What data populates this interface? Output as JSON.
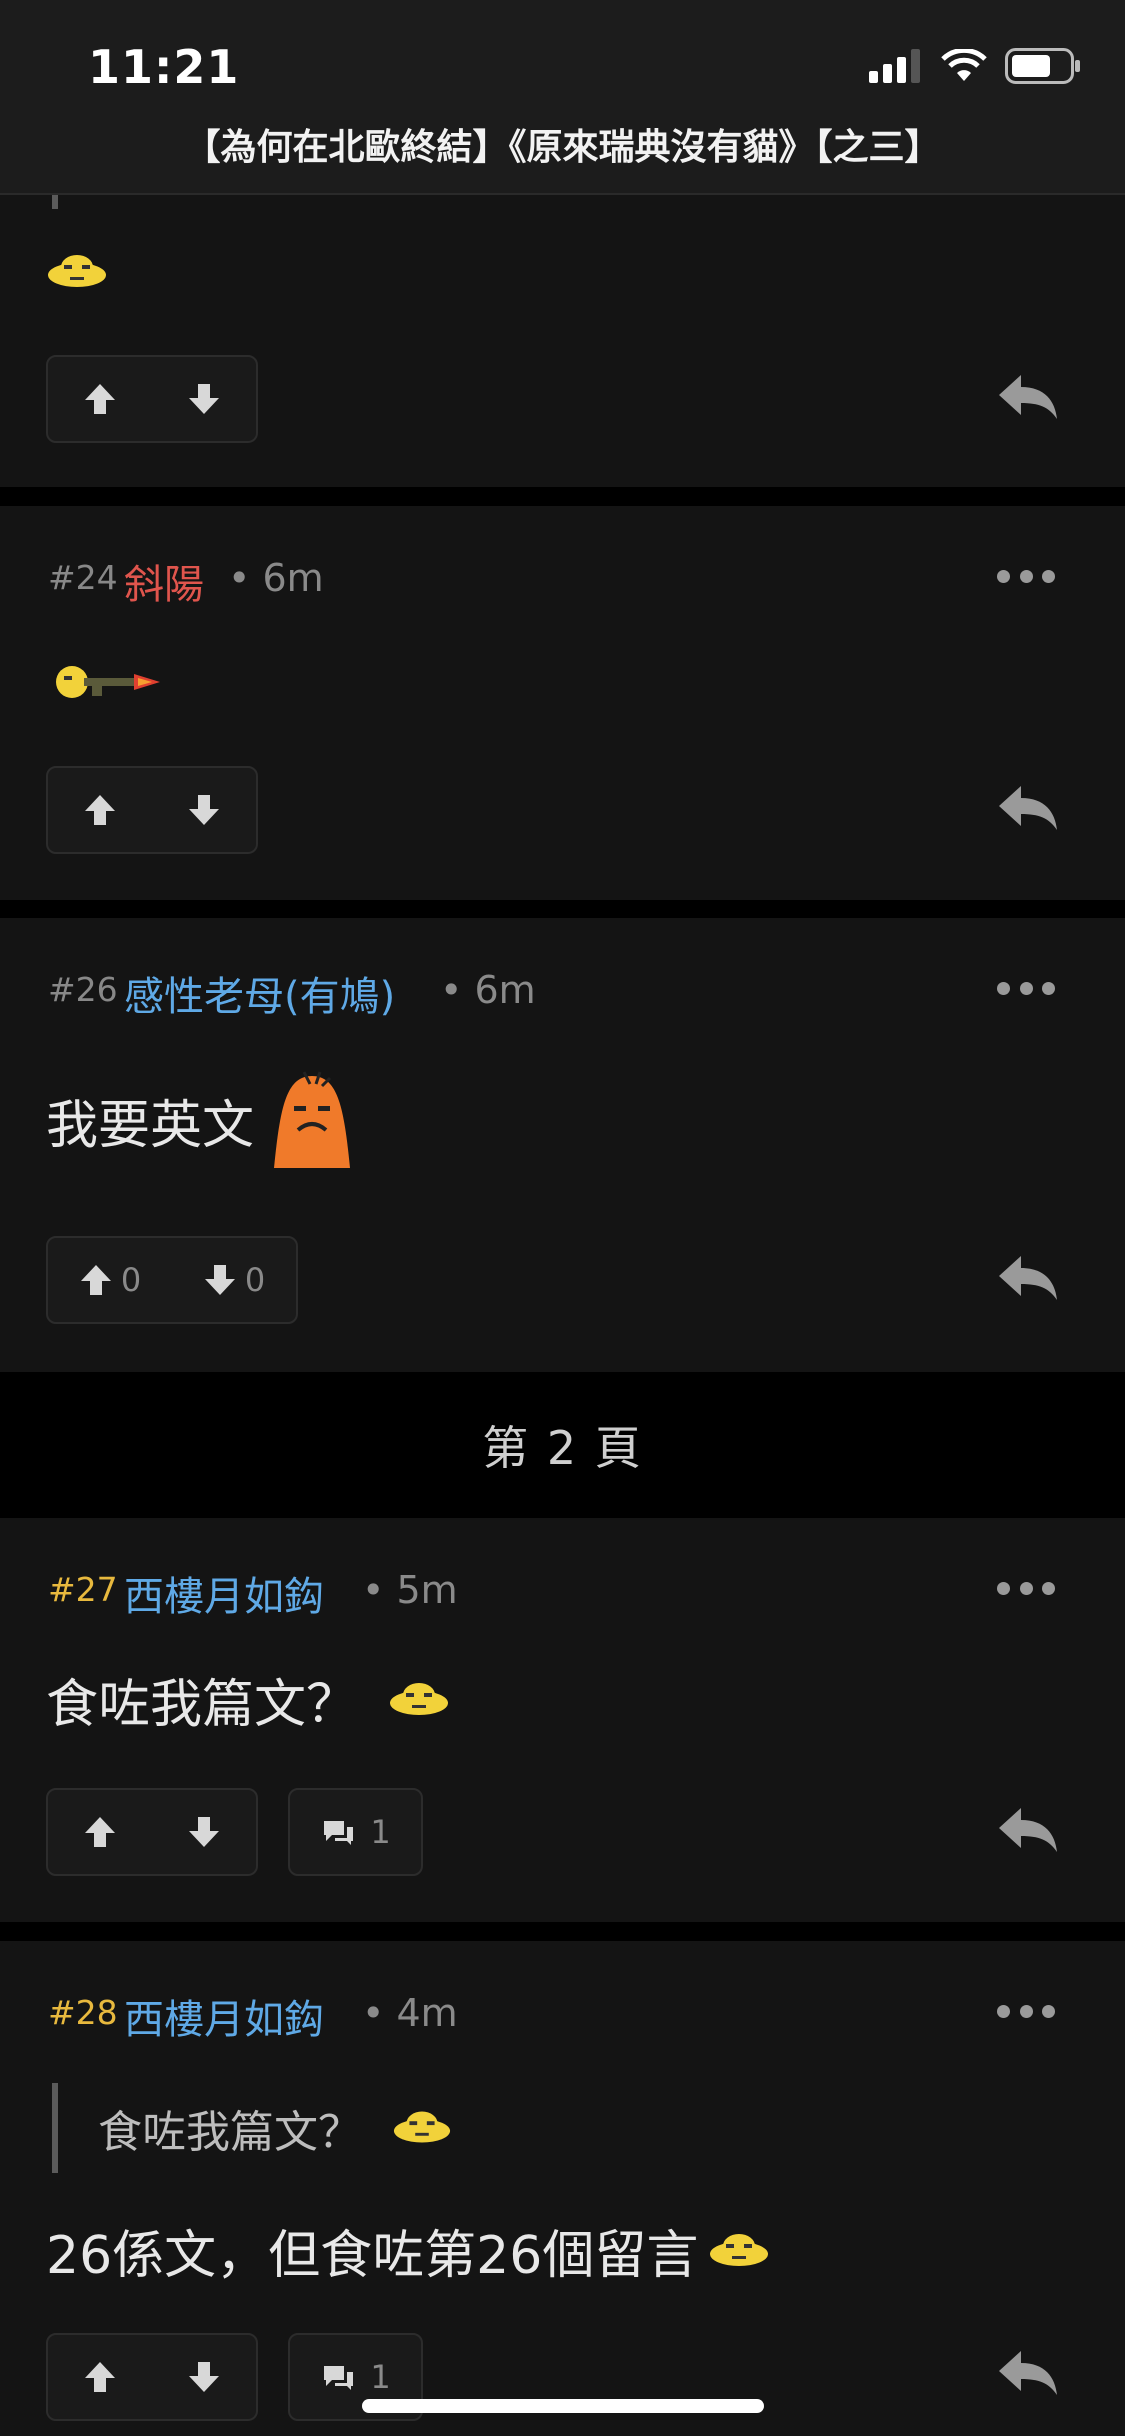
{
  "status_bar": {
    "time": "11:21"
  },
  "header": {
    "title": "【為何在北歐終結】《原來瑞典沒有貓》【之三】"
  },
  "posts": [
    {
      "number": "#24",
      "username": "斜陽",
      "time": "• 6m"
    },
    {
      "number": "#26",
      "username": "感性老母(有鳩)",
      "time": "• 6m",
      "text": "我要英文",
      "upvotes": "0",
      "downvotes": "0"
    },
    {
      "number": "#27",
      "username": "西樓月如鈎",
      "time": "• 5m",
      "text": "食咗我篇文？",
      "comments": "1"
    },
    {
      "number": "#28",
      "username": "西樓月如鈎",
      "time": "• 4m",
      "quote": "食咗我篇文？",
      "text": "26係文，但食咗第26個留言",
      "comments": "1"
    }
  ],
  "page_separator": "第 2 頁",
  "colors": {
    "accent_gold": "#e8b93e",
    "username_red": "#e0554d",
    "username_blue": "#5fa9e6",
    "background": "#141414"
  }
}
